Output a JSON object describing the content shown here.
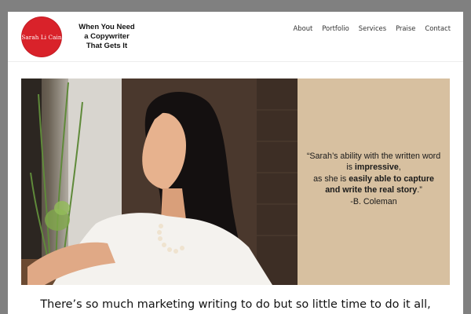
{
  "header": {
    "logo_text": "Sarah Li Cain",
    "tagline_lines": [
      "When You Need",
      "a Copywriter",
      "That Gets It"
    ],
    "nav": [
      "About",
      "Portfolio",
      "Services",
      "Praise",
      "Contact"
    ]
  },
  "hero": {
    "quote": {
      "line1": "“Sarah’s ability with the written word",
      "line2_pre": "is ",
      "line2_bold": "impressive",
      "line2_post": ",",
      "line3_pre": "as she is ",
      "line3_bold": "easily able to capture",
      "line4_bold": "and write the real story",
      "line4_post": ".”",
      "author": "-B. Coleman"
    }
  },
  "intro": {
    "text": "There’s so much marketing writing to do but so little time to do it all,"
  },
  "colors": {
    "logo_red": "#d9222a",
    "quote_panel": "#d7c0a0"
  }
}
